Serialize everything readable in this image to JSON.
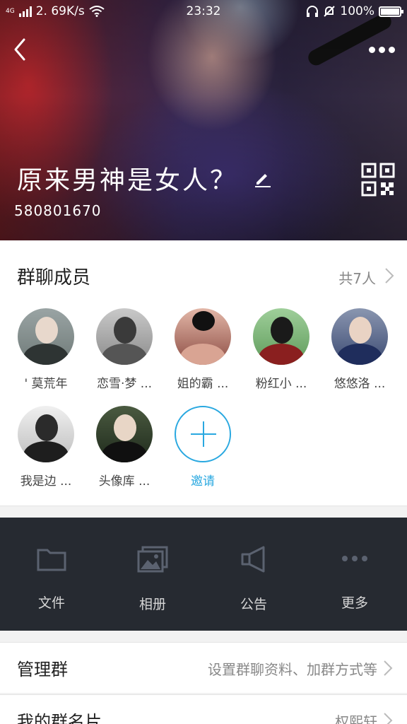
{
  "status": {
    "network": "4G",
    "speed": "2. 69K/s",
    "time": "23:32",
    "battery": "100%"
  },
  "group": {
    "name": "原来男神是女人？",
    "id": "580801670"
  },
  "members": {
    "title": "群聊成员",
    "count_label": "共7人",
    "items": [
      {
        "name": "' 莫荒年"
      },
      {
        "name": "恋雪·梦 ..."
      },
      {
        "name": "姐的霸 ..."
      },
      {
        "name": "粉红小 ..."
      },
      {
        "name": "悠悠洛 ..."
      },
      {
        "name": "我是边 ..."
      },
      {
        "name": "头像库 ..."
      }
    ],
    "invite_label": "邀请"
  },
  "tools": [
    {
      "label": "文件",
      "icon": "folder-icon"
    },
    {
      "label": "相册",
      "icon": "album-icon"
    },
    {
      "label": "公告",
      "icon": "megaphone-icon"
    },
    {
      "label": "更多",
      "icon": "more-dots-icon"
    }
  ],
  "settings": {
    "manage": {
      "title": "管理群",
      "value": "设置群聊资料、加群方式等"
    },
    "card": {
      "title": "我的群名片",
      "value": "权熙轩"
    }
  }
}
